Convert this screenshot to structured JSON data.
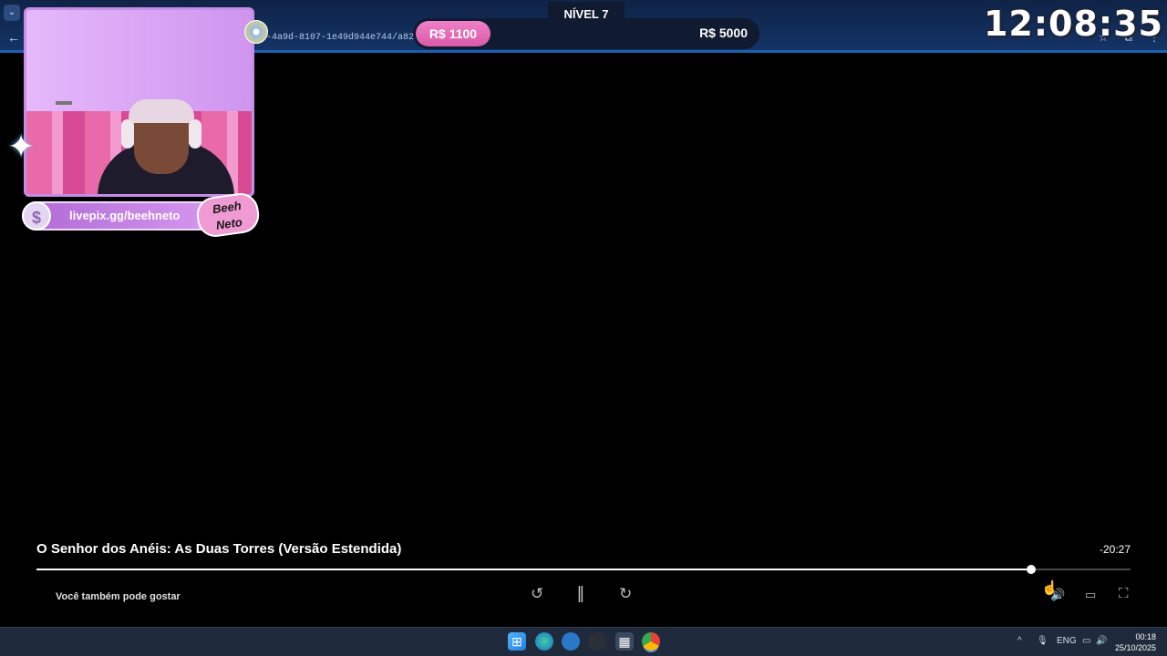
{
  "browser": {
    "url": "-4a9d-8107-1e49d944e744/a82c4890-",
    "back_icon": "arrow-left-icon",
    "tab_dropdown_icon": "chevron-down-icon",
    "toolbar_icons": [
      "star-icon",
      "extensions-icon",
      "menu-icon"
    ]
  },
  "stream_overlay": {
    "clock": "12:08:35",
    "goal": {
      "level": "NÍVEL 7",
      "current": "R$ 1100",
      "target": "R$ 5000",
      "progress_fraction": 0.22
    },
    "pix_link": "livepix.gg/beehneto",
    "pix_coin_symbol": "$",
    "logo_text": "Beeh Neto",
    "accent_color": "#e07ac0"
  },
  "player": {
    "title": "O Senhor dos Anéis: As Duas Torres (Versão Estendida)",
    "time_remaining": "-20:27",
    "progress_fraction": 0.909,
    "also_like": "Você também pode gostar",
    "controls": {
      "rewind": "↺",
      "pause": "||",
      "forward": "↻",
      "volume": "🔊",
      "subtitles": "▭",
      "fullscreen": "⛶"
    }
  },
  "taskbar": {
    "apps": [
      "windows-start-icon",
      "edge-icon",
      "app-icon",
      "app-icon",
      "calculator-icon",
      "chrome-icon"
    ],
    "tray": {
      "chevron": "^",
      "mic": "🎙",
      "language": "ENG",
      "network": "▭",
      "volume": "🔊"
    },
    "time": "00:18",
    "date": "25/10/2025"
  }
}
